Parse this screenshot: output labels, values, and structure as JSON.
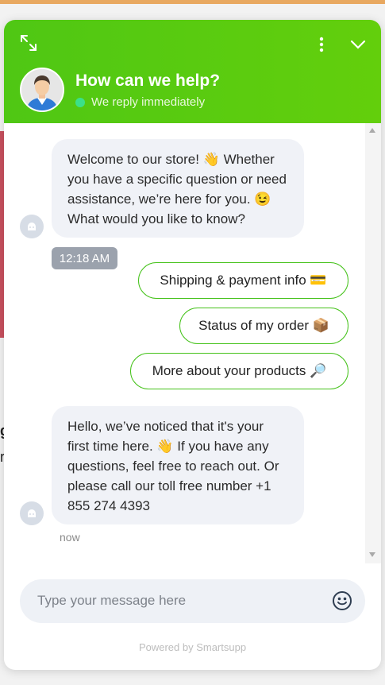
{
  "header": {
    "title": "How can we help?",
    "status": "We reply immediately",
    "accent": "#52c814"
  },
  "messages": [
    {
      "from": "bot",
      "text": "Welcome to our store! 👋 Whether you have a specific question or need assistance, we’re here for you. 😉 What would you like to know?"
    },
    {
      "from": "bot",
      "text": "Hello, we’ve noticed that it's your first time here. 👋  If you have any questions, feel free to reach out. Or please call our toll free number +1 855 274 4393"
    }
  ],
  "time_badge": "12:18 AM",
  "quick_replies": [
    {
      "label": "Shipping & payment info 💳"
    },
    {
      "label": "Status of my order 📦"
    },
    {
      "label": "More about your products 🔎"
    }
  ],
  "last_time": "now",
  "composer": {
    "placeholder": "Type your message here"
  },
  "powered_by": "Powered by Smartsupp",
  "icons": {
    "expand": "expand-icon",
    "menu": "more-vertical-icon",
    "collapse": "chevron-down-icon",
    "avatar": "agent-avatar",
    "bot": "chat-bot-icon",
    "emoji": "smile-icon"
  }
}
